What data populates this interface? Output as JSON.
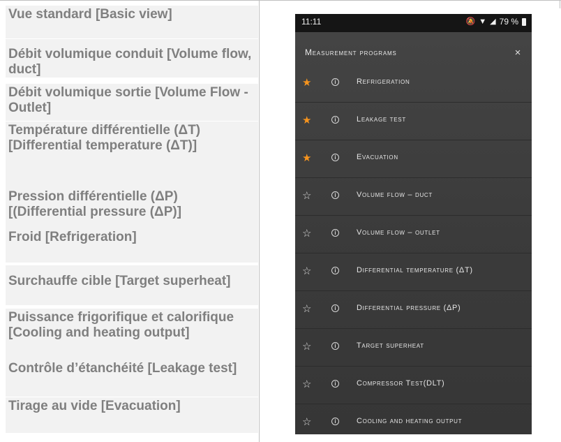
{
  "table": {
    "labels": [
      "Vue standard [Basic view]",
      "Débit volumique conduit [Volume flow, duct]",
      "Débit volumique sortie [Volume Flow - Outlet]",
      "Température différentielle (ΔT) [Differential temperature (ΔT)]",
      "Pression différentielle (ΔP) [(Differential pressure (ΔP)]",
      "Froid [Refrigeration]",
      "Surchauffe cible [Target superheat]",
      "Puissance frigorifique et calorifique [Cooling and heating output]",
      "Contrôle d’étanchéité [Leakage test]",
      "Tirage au vide [Evacuation]"
    ]
  },
  "phone": {
    "status_bar": {
      "time": "11:11",
      "battery": "79 %"
    },
    "panel": {
      "title": "Measurement programs",
      "close_label": "×",
      "programs": [
        {
          "label": "Refrigeration",
          "favorite": true
        },
        {
          "label": "Leakage test",
          "favorite": true
        },
        {
          "label": "Evacuation",
          "favorite": true
        },
        {
          "label": "Volume flow – duct",
          "favorite": false
        },
        {
          "label": "Volume flow – outlet",
          "favorite": false
        },
        {
          "label": "Differential temperature (ΔT)",
          "favorite": false
        },
        {
          "label": "Differential pressure (ΔP)",
          "favorite": false
        },
        {
          "label": "Target superheat",
          "favorite": false
        },
        {
          "label": "Compressor Test(DLT)",
          "favorite": false
        },
        {
          "label": "Cooling and heating output",
          "favorite": false
        }
      ]
    },
    "colors": {
      "favorite_star": "#f7941d",
      "panel_bg": "#3a3a3a",
      "status_bar_bg": "#151515"
    },
    "icons": {
      "favorite": "star-filled-icon",
      "not_favorite": "star-outline-icon",
      "info": "info-icon",
      "status": [
        "mute-icon",
        "wifi-icon",
        "signal-icon",
        "battery-icon"
      ]
    }
  }
}
